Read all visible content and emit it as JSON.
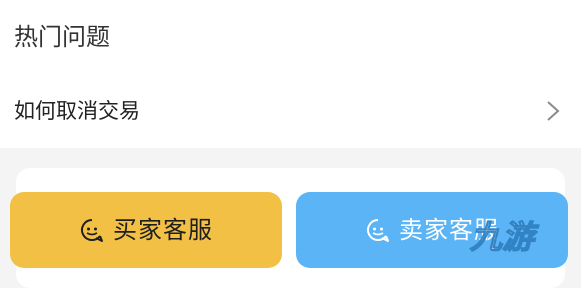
{
  "section": {
    "title": "热门问题"
  },
  "faq": [
    {
      "label": "如何取消交易"
    }
  ],
  "actions": {
    "buyer_service_label": "买家客服",
    "seller_service_label": "卖家客服"
  },
  "watermark": {
    "text": "九游"
  },
  "colors": {
    "buyer_button": "#f2c045",
    "seller_button": "#5ab4f5",
    "band_background": "#f4f4f4"
  },
  "icons": {
    "faq_chevron": "chevron-right-icon",
    "service": "smiley-chat-icon"
  }
}
